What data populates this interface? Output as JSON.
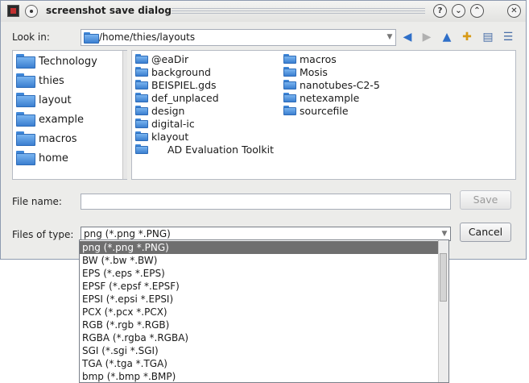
{
  "window": {
    "title": "screenshot save dialog"
  },
  "titlebar": {
    "help_glyph": "?",
    "minimize_glyph": "⌄",
    "maximize_glyph": "⌃",
    "close_glyph": "✕"
  },
  "lookin": {
    "label": "Look in:",
    "path": "/home/thies/layouts"
  },
  "sidebar": {
    "items": [
      "Technology",
      "thies",
      "layout",
      "example",
      "macros",
      "home"
    ]
  },
  "files": {
    "col1": [
      {
        "name": "@eaDir",
        "icon": "folder-icon"
      },
      {
        "name": "background",
        "icon": "folder-icon"
      },
      {
        "name": "BEISPIEL.gds",
        "icon": "folder-icon"
      },
      {
        "name": "def_unplaced",
        "icon": "folder-icon"
      },
      {
        "name": "design",
        "icon": "folder-icon"
      },
      {
        "name": "digital-ic",
        "icon": "folder-icon"
      },
      {
        "name": "klayout",
        "icon": "folder-icon"
      },
      {
        "name": "AD Evaluation Toolkit",
        "icon": "file-icon"
      }
    ],
    "col2": [
      {
        "name": "macros",
        "icon": "folder-icon"
      },
      {
        "name": "Mosis",
        "icon": "folder-icon"
      },
      {
        "name": "nanotubes-C2-5",
        "icon": "folder-icon"
      },
      {
        "name": "netexample",
        "icon": "folder-icon"
      },
      {
        "name": "sourcefile",
        "icon": "folder-icon"
      }
    ]
  },
  "filename": {
    "label": "File name:",
    "value": "",
    "save_label": "Save"
  },
  "filetype": {
    "label": "Files of type:",
    "selected": "png (*.png *.PNG)",
    "cancel_label": "Cancel",
    "options": [
      "png (*.png *.PNG)",
      "BW (*.bw *.BW)",
      "EPS (*.eps *.EPS)",
      "EPSF (*.epsf *.EPSF)",
      "EPSI (*.epsi *.EPSI)",
      "PCX (*.pcx *.PCX)",
      "RGB (*.rgb *.RGB)",
      "RGBA (*.rgba *.RGBA)",
      "SGI (*.sgi *.SGI)",
      "TGA (*.tga *.TGA)",
      "bmp (*.bmp *.BMP)"
    ]
  },
  "colors": {
    "highlight": "#6f6f6f",
    "folder": "#4a8fde",
    "window_bg": "#ececea"
  }
}
